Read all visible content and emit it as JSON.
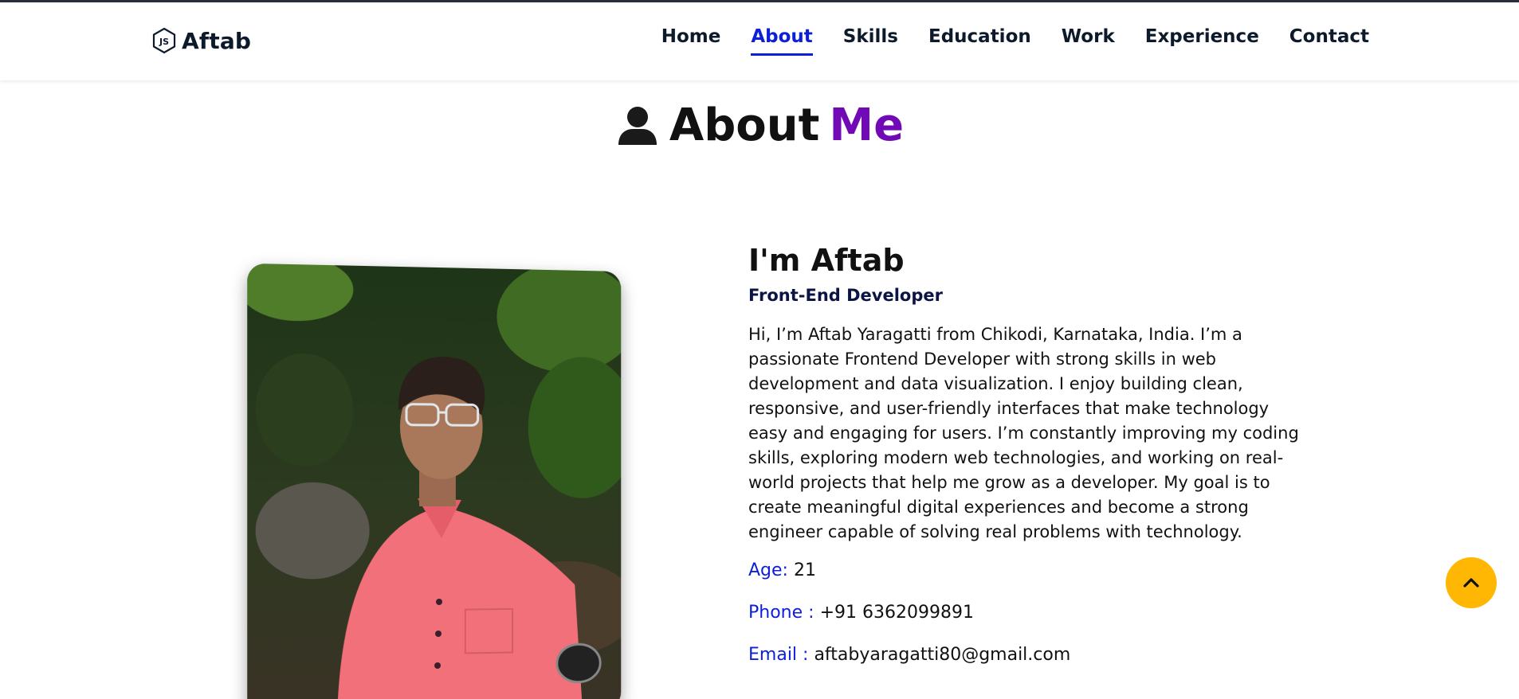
{
  "brand": {
    "name": "Aftab",
    "icon": "nodejs-hexagon-icon"
  },
  "nav": {
    "items": [
      {
        "label": "Home",
        "active": false
      },
      {
        "label": "About",
        "active": true
      },
      {
        "label": "Skills",
        "active": false
      },
      {
        "label": "Education",
        "active": false
      },
      {
        "label": "Work",
        "active": false
      },
      {
        "label": "Experience",
        "active": false
      },
      {
        "label": "Contact",
        "active": false
      }
    ]
  },
  "section": {
    "title_main": "About",
    "title_accent": "Me",
    "icon": "user-icon"
  },
  "profile": {
    "heading": "I'm Aftab",
    "role": "Front-End Developer",
    "description": "Hi, I’m Aftab Yaragatti from Chikodi, Karnataka, India. I’m a passionate Frontend Developer with strong skills in web development and data visualization. I enjoy building clean, responsive, and user-friendly interfaces that make technology easy and engaging for users. I’m constantly improving my coding skills, exploring modern web technologies, and working on real-world projects that help me grow as a developer. My goal is to create meaningful digital experiences and become a strong engineer capable of solving real problems with technology.",
    "age_label": "Age:",
    "age_value": "21",
    "phone_label": "Phone :",
    "phone_value": "+91 6362099891",
    "email_label": "Email :",
    "email_value": "aftabyaragatti80@gmail.com"
  },
  "colors": {
    "accent": "#7209b7",
    "link_blue": "#0d1fd8",
    "scroll_button": "#ffb703",
    "text_dark": "#0c1a2b"
  },
  "scroll_top": {
    "icon": "chevron-up-icon"
  }
}
